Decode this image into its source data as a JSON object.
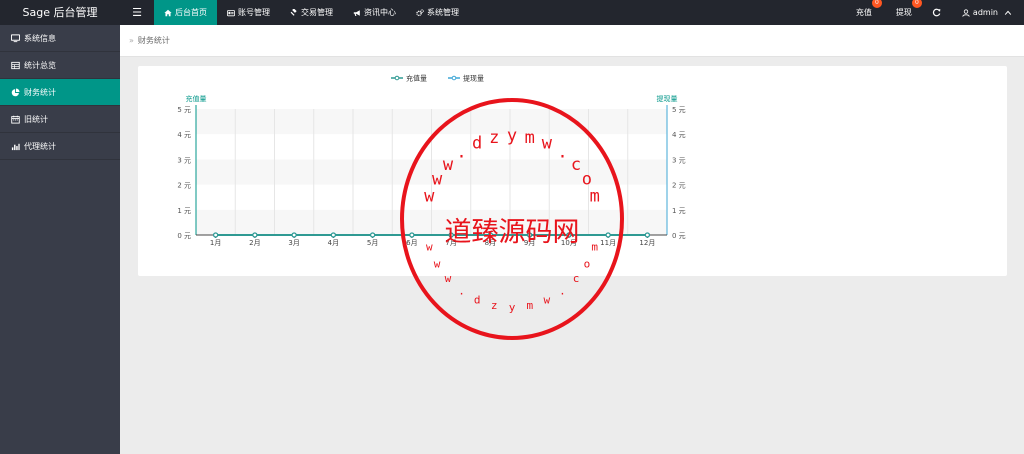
{
  "brand": "Sage 后台管理",
  "menu_toggle": "☰",
  "nav": [
    {
      "label": "后台首页",
      "icon": "home-icon",
      "active": true
    },
    {
      "label": "账号管理",
      "icon": "id-card-icon",
      "active": false
    },
    {
      "label": "交易管理",
      "icon": "gavel-icon",
      "active": false
    },
    {
      "label": "资讯中心",
      "icon": "bullhorn-icon",
      "active": false
    },
    {
      "label": "系统管理",
      "icon": "cogs-icon",
      "active": false
    }
  ],
  "right_nav": {
    "recharge": {
      "label": "充值",
      "badge": "0"
    },
    "withdraw": {
      "label": "提现",
      "badge": "0"
    },
    "refresh_icon": "refresh-icon",
    "user": {
      "label": "admin",
      "icon": "user-icon",
      "caret": "chevron-up-icon"
    }
  },
  "sidebar": [
    {
      "label": "系统信息",
      "icon": "desktop-icon",
      "active": false
    },
    {
      "label": "统计总览",
      "icon": "table-icon",
      "active": false
    },
    {
      "label": "财务统计",
      "icon": "pie-chart-icon",
      "active": true
    },
    {
      "label": "旧统计",
      "icon": "calendar-icon",
      "active": false
    },
    {
      "label": "代理统计",
      "icon": "bar-chart-icon",
      "active": false
    }
  ],
  "breadcrumb": {
    "sep": "»",
    "current": "财务统计"
  },
  "colors": {
    "topbar": "#23262e",
    "sidebar": "#393d49",
    "accent": "#009688",
    "badge": "#ff5722",
    "series_recharge": "#2f9a93",
    "series_withdraw": "#3fa7d6",
    "stamp": "#e8141c"
  },
  "chart_data": {
    "type": "line",
    "title": "",
    "categories": [
      "1月",
      "2月",
      "3月",
      "4月",
      "5月",
      "6月",
      "7月",
      "8月",
      "9月",
      "10月",
      "11月",
      "12月"
    ],
    "series": [
      {
        "name": "充值量",
        "values": [
          0,
          0,
          0,
          0,
          0,
          0,
          0,
          0,
          0,
          0,
          0,
          0
        ],
        "axis": "left"
      },
      {
        "name": "提现量",
        "values": [
          0,
          0,
          0,
          0,
          0,
          0,
          0,
          0,
          0,
          0,
          0,
          0
        ],
        "axis": "right"
      }
    ],
    "ylabel_left": "充值量",
    "ylabel_right": "提现量",
    "y_ticks": [
      "0 元",
      "1 元",
      "2 元",
      "3 元",
      "4 元",
      "5 元"
    ],
    "ylim": [
      0,
      5
    ],
    "legend": "top-center",
    "grid": true
  },
  "watermark": {
    "top_text": [
      "w",
      "w",
      "w",
      ".",
      "d",
      "z",
      "y",
      "m",
      "w",
      ".",
      "c",
      "o",
      "m"
    ],
    "center_text": "道臻源码网",
    "bottom_text": [
      "w",
      "w",
      "w",
      ".",
      "d",
      "z",
      "y",
      "m",
      "w",
      ".",
      "c",
      "o",
      "m"
    ]
  }
}
